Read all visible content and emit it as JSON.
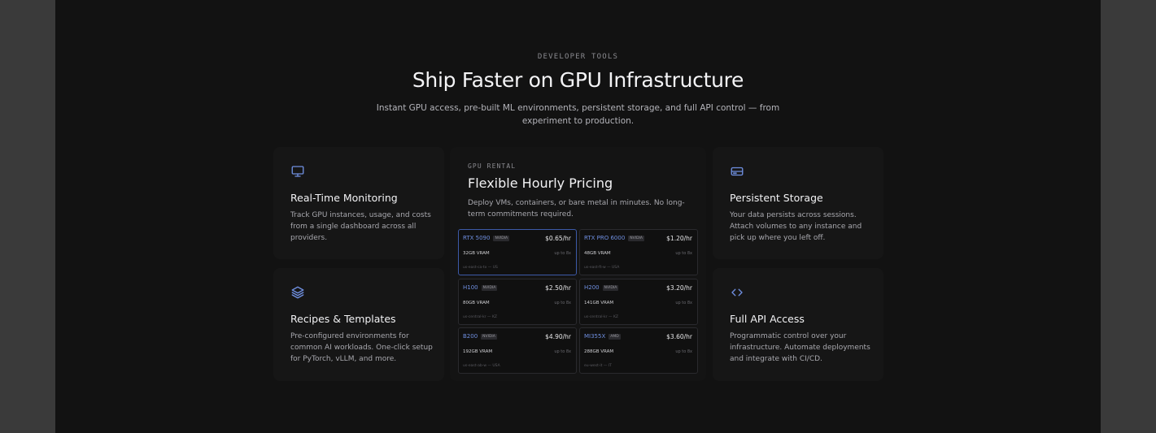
{
  "section": {
    "eyebrow": "DEVELOPER TOOLS",
    "title": "Ship Faster on GPU Infrastructure",
    "subtitle": "Instant GPU access, pre-built ML environments, persistent storage, and full API control — from experiment to production."
  },
  "features": {
    "monitoring": {
      "icon": "monitor-icon",
      "title": "Real-Time Monitoring",
      "text": "Track GPU instances, usage, and costs from a single dashboard across all providers."
    },
    "recipes": {
      "icon": "layers-icon",
      "title": "Recipes & Templates",
      "text": "Pre-configured environments for common AI workloads. One-click setup for PyTorch, vLLM, and more."
    },
    "storage": {
      "icon": "hard-drive-icon",
      "title": "Persistent Storage",
      "text": "Your data persists across sessions. Attach volumes to any instance and pick up where you left off."
    },
    "api": {
      "icon": "code-icon",
      "title": "Full API Access",
      "text": "Programmatic control over your infrastructure. Automate deployments and integrate with CI/CD."
    }
  },
  "rental": {
    "eyebrow": "GPU RENTAL",
    "title": "Flexible Hourly Pricing",
    "text": "Deploy VMs, containers, or bare metal in minutes. No long-term commitments required.",
    "gpus": [
      {
        "name": "RTX 5090",
        "tag": "NVIDIA",
        "price": "$0.65/hr",
        "vram": "32GB VRAM",
        "upto": "up to 8x",
        "region": "us-east-ca-tx — US"
      },
      {
        "name": "RTX PRO 6000",
        "tag": "NVIDIA",
        "price": "$1.20/hr",
        "vram": "48GB VRAM",
        "upto": "up to 8x",
        "region": "us-east-ft-w — USA"
      },
      {
        "name": "H100",
        "tag": "NVIDIA",
        "price": "$2.50/hr",
        "vram": "80GB VRAM",
        "upto": "up to 8x",
        "region": "us-central-kr — KZ"
      },
      {
        "name": "H200",
        "tag": "NVIDIA",
        "price": "$3.20/hr",
        "vram": "141GB VRAM",
        "upto": "up to 8x",
        "region": "us-central-kr — KZ"
      },
      {
        "name": "B200",
        "tag": "NVIDIA",
        "price": "$4.90/hr",
        "vram": "192GB VRAM",
        "upto": "up to 8x",
        "region": "us-east-ab-w — USA"
      },
      {
        "name": "MI355X",
        "tag": "AMD",
        "price": "$3.60/hr",
        "vram": "288GB VRAM",
        "upto": "up to 8x",
        "region": "eu-west-it — IT"
      }
    ]
  }
}
